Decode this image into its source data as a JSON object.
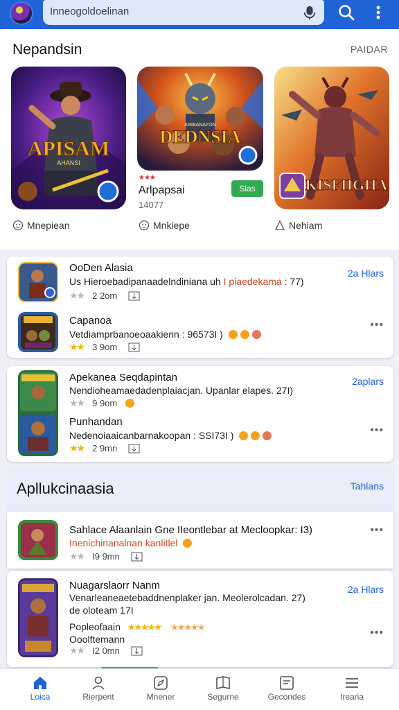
{
  "topbar": {
    "search_text": "Inneogoldoelinan",
    "icons": [
      "avatar",
      "mic-icon",
      "search-icon",
      "more-vert-icon"
    ]
  },
  "featured": {
    "title": "Nepandsin",
    "more_label": "PAIDAR",
    "cards": [
      {
        "art_text": "APISAM",
        "art_sub": "AHANSI",
        "tag": "Mnepiean",
        "tag_icon": "emoji-icon"
      },
      {
        "art_text": "DEDNSIA",
        "art_sub": "ANIBANAYON",
        "rating_marks": "★★★",
        "title": "Arlpapsai",
        "sub": "14077",
        "button": "Slas",
        "tag": "Mnkiepe",
        "tag_icon": "face-icon"
      },
      {
        "art_text": "KISFIIGHA",
        "tag": "Nehiam",
        "tag_icon": "user-icon"
      }
    ]
  },
  "list_card_1": {
    "right_link": "2a Hlars",
    "items": [
      {
        "name": "OoDen Alasia",
        "desc": "Us Hieroebadipanaadelndiniana uh",
        "desc_highlight": "I piaedekama",
        "desc_tail": ": 77)",
        "stars": "★★",
        "star_color": "grey",
        "size": "2 2om",
        "id": "item-1"
      },
      {
        "name": "Capanoa",
        "desc": "Vetdiamprbanoeoaakienn : 96573I )",
        "stars": "★★",
        "star_color": "yellow",
        "size": "3 9om",
        "id": "item-2"
      }
    ]
  },
  "list_card_2": {
    "right_link": "2aplars",
    "items": [
      {
        "name": "Apekanea Seqdapintan",
        "desc": "Nendioheamaedadenplaiacjan. Upanlar elapes. 27I)",
        "stars": "★★",
        "star_color": "grey",
        "size": "9 9om",
        "id": "item-3"
      },
      {
        "name": "Punhandan",
        "desc": "Nedenoiaaicanbarnakoopan : SSI73I )",
        "stars": "★★",
        "star_color": "yellow",
        "size": "2 9mn",
        "id": "item-4"
      }
    ]
  },
  "section2": {
    "title": "Apllukcinaasia",
    "link": "Tahlans"
  },
  "list_card_3": {
    "items": [
      {
        "name": "Sahlace Alaanlain Gne IIeontlebar at Mecloopkar: I3)",
        "desc": "Inenichinanalnan kanlitlel",
        "stars": "★★",
        "star_color": "grey",
        "size": "I9 9mn",
        "id": "item-5"
      }
    ]
  },
  "list_card_4": {
    "right_link": "2a Hlars",
    "items": [
      {
        "name": "Nuagarslaorr Nanm",
        "desc": "Venarleaneaetebaddnenplaker jan. Meolerolcadan. 27)",
        "extra": "de oloteam 17I",
        "sub_name": "Popleofaain",
        "sub_stars": "★★★★★",
        "sub_stars2": "★★★★★",
        "sub_desc": "Ooolftemann",
        "stars": "★★",
        "star_color": "grey",
        "size": "I2 0mn",
        "id": "item-6"
      }
    ]
  },
  "bottom_nav": [
    {
      "label": "Loica",
      "icon": "home-icon",
      "active": true
    },
    {
      "label": "Rierpent",
      "icon": "person-icon",
      "active": false
    },
    {
      "label": "Mnener",
      "icon": "compass-icon",
      "active": false
    },
    {
      "label": "Segurne",
      "icon": "book-icon",
      "active": false
    },
    {
      "label": "Gecondes",
      "icon": "list-box-icon",
      "active": false
    },
    {
      "label": "Irearia",
      "icon": "menu-icon",
      "active": false
    }
  ],
  "colors": {
    "brand": "#1f63d6",
    "install_green": "#34a853",
    "star_yellow": "#f2b705"
  }
}
